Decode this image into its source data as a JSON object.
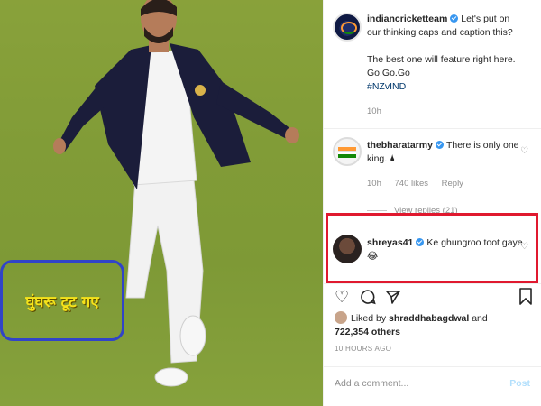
{
  "photo": {
    "caption_overlay": "घुंघरू टूट गए"
  },
  "post": {
    "author": {
      "username": "indiancricketteam",
      "verified": true,
      "text_lines": [
        "Let's put on our thinking caps and caption this?",
        "The best one will feature right here. Go.Go.Go"
      ],
      "hashtag": "#NZvIND",
      "time": "10h"
    },
    "comments": [
      {
        "username": "thebharatarmy",
        "verified": true,
        "text": "There is only one king. 🌢",
        "time": "10h",
        "likes": "740 likes",
        "reply_label": "Reply"
      },
      {
        "username": "shreyas41",
        "verified": true,
        "text": "Ke ghungroo toot gaye 😂",
        "highlighted": true,
        "highlight_color": "#e0192f"
      }
    ],
    "view_replies": "View replies (21)",
    "liked_by_prefix": "Liked by",
    "liked_by_user": "shraddhabagdwal",
    "liked_by_and": "and",
    "liked_by_others": "722,354 others",
    "timestamp": "10 HOURS AGO",
    "add_comment_placeholder": "Add a comment...",
    "post_button": "Post"
  },
  "icons": [
    "heart-icon",
    "comment-icon",
    "share-icon",
    "bookmark-icon"
  ],
  "colors": {
    "verified_blue": "#3897f0",
    "caption_box_border": "#3144c8",
    "caption_text": "#f5e21a",
    "post_button_disabled": "#b2dffc"
  }
}
